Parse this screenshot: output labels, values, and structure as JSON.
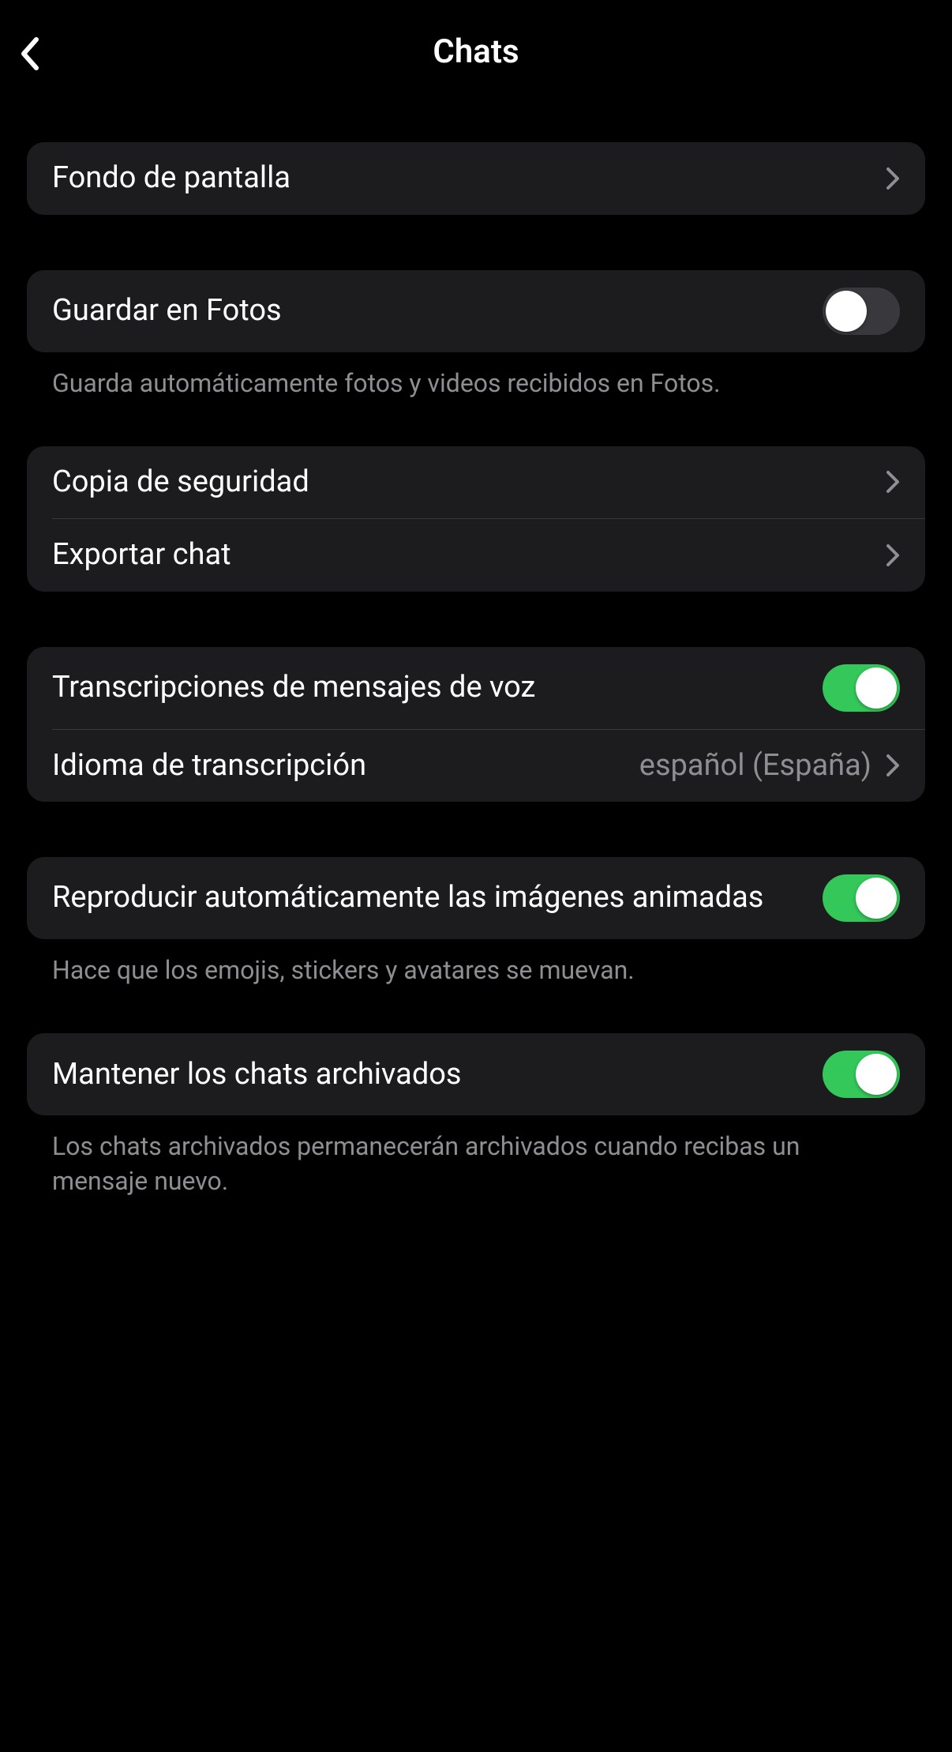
{
  "header": {
    "title": "Chats"
  },
  "sections": {
    "wallpaper": {
      "label": "Fondo de pantalla"
    },
    "save_photos": {
      "label": "Guardar en Fotos",
      "toggle": false,
      "footer": "Guarda automáticamente fotos y videos recibidos en Fotos."
    },
    "backup": {
      "label": "Copia de seguridad"
    },
    "export": {
      "label": "Exportar chat"
    },
    "transcriptions": {
      "label": "Transcripciones de mensajes de voz",
      "toggle": true
    },
    "transcription_language": {
      "label": "Idioma de transcripción",
      "value": "español (España)"
    },
    "autoplay": {
      "label": "Reproducir automáticamente las imágenes animadas",
      "toggle": true,
      "footer": "Hace que los emojis, stickers y avatares se muevan."
    },
    "keep_archived": {
      "label": "Mantener los chats archivados",
      "toggle": true,
      "footer": "Los chats archivados permanecerán archivados cuando recibas un mensaje nuevo."
    }
  }
}
